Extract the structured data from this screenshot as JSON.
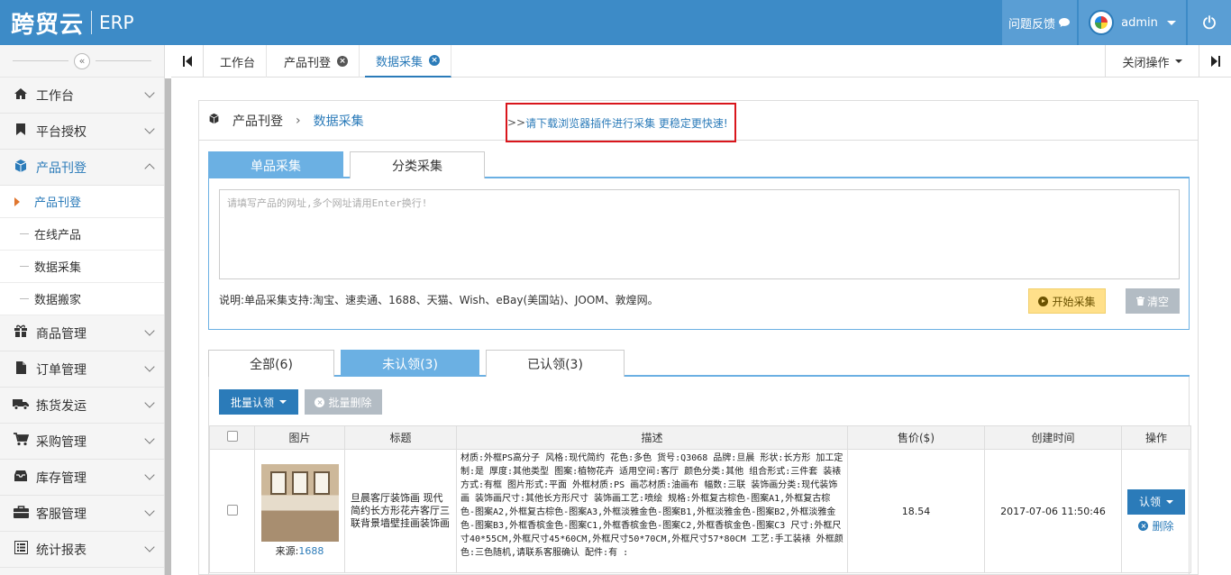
{
  "header": {
    "logo_text": "跨贸云",
    "logo_sub": "ERP",
    "feedback": "问题反馈",
    "user": "admin"
  },
  "sidebar": {
    "items": [
      {
        "label": "工作台",
        "icon": "home-icon"
      },
      {
        "label": "平台授权",
        "icon": "bookmark-icon"
      },
      {
        "label": "产品刊登",
        "icon": "cube-icon",
        "subitems": [
          "产品刊登",
          "在线产品",
          "数据采集",
          "数据搬家"
        ]
      },
      {
        "label": "商品管理",
        "icon": "gift-icon"
      },
      {
        "label": "订单管理",
        "icon": "file-icon"
      },
      {
        "label": "拣货发运",
        "icon": "truck-icon"
      },
      {
        "label": "采购管理",
        "icon": "cart-icon"
      },
      {
        "label": "库存管理",
        "icon": "inbox-icon"
      },
      {
        "label": "客服管理",
        "icon": "briefcase-icon"
      },
      {
        "label": "统计报表",
        "icon": "list-icon"
      }
    ]
  },
  "tabs": {
    "items": [
      "工作台",
      "产品刊登",
      "数据采集"
    ],
    "close_ops": "关闭操作"
  },
  "breadcrumb": {
    "parent": "产品刊登",
    "sep": "›",
    "current": "数据采集"
  },
  "collect": {
    "tab_single": "单品采集",
    "tab_category": "分类采集",
    "plugin_prefix": ">>",
    "plugin_note": "请下载浏览器插件进行采集 更稳定更快速!",
    "placeholder": "请填写产品的网址,多个网址请用Enter换行!",
    "support_text": "说明:单品采集支持:淘宝、速卖通、1688、天猫、Wish、eBay(美国站)、JOOM、敦煌网。",
    "start_btn": "开始采集",
    "clear_btn": "清空"
  },
  "list": {
    "tab_all": "全部(6)",
    "tab_unclaimed": "未认领(3)",
    "tab_claimed": "已认领(3)",
    "batch_claim": "批量认领",
    "batch_delete": "批量删除",
    "columns": [
      "图片",
      "标题",
      "描述",
      "售价($)",
      "创建时间",
      "操作"
    ],
    "rows": [
      {
        "source_label": "来源:",
        "source": "1688",
        "title": "旦晨客厅装饰画 现代简约长方形花卉客厅三联背景墙壁挂画装饰画",
        "desc": "材质:外框PS高分子 风格:现代简约 花色:多色 货号:Q3068 品牌:旦晨 形状:长方形 加工定制:是 厚度:其他类型 图案:植物花卉 适用空间:客厅 颜色分类:其他 组合形式:三件套 装裱方式:有框 图片形式:平面 外框材质:PS 画芯材质:油画布 幅数:三联 装饰画分类:现代装饰画 装饰画尺寸:其他长方形尺寸 装饰画工艺:喷绘 规格:外框复古棕色-图案A1,外框复古棕色-图案A2,外框复古棕色-图案A3,外框淡雅金色-图案B1,外框淡雅金色-图案B2,外框淡雅金色-图案B3,外框香槟金色-图案C1,外框香槟金色-图案C2,外框香槟金色-图案C3 尺寸:外框尺寸40*55CM,外框尺寸45*60CM,外框尺寸50*70CM,外框尺寸57*80CM 工艺:手工装裱 外框颜色:三色随机,请联系客服确认 配件:有 :",
        "price": "18.54",
        "created": "2017-07-06 11:50:46",
        "claim_btn": "认领",
        "delete_link": "删除"
      }
    ]
  }
}
